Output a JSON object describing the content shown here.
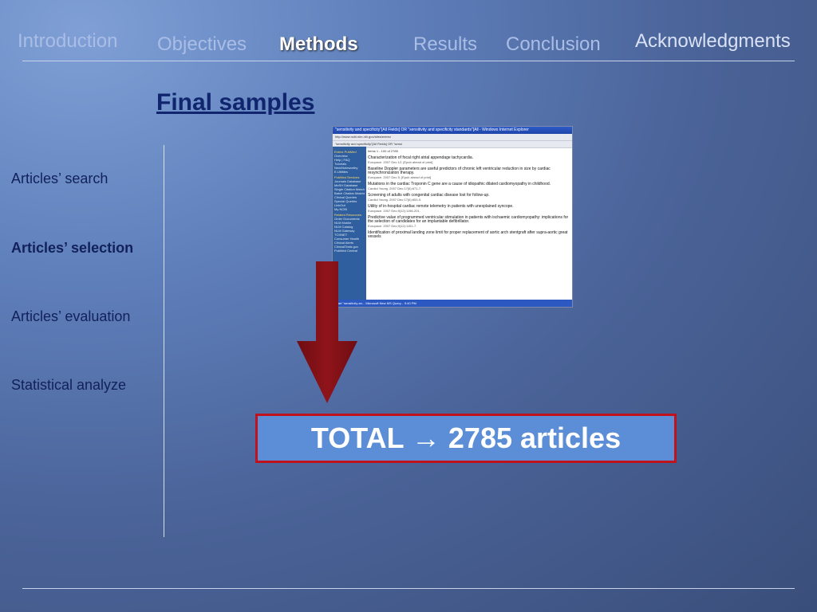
{
  "nav": {
    "items": [
      {
        "label": "Introduction",
        "active": false
      },
      {
        "label": "Objectives",
        "active": false
      },
      {
        "label": "Methods",
        "active": true
      },
      {
        "label": "Results",
        "active": false
      },
      {
        "label": "Conclusion",
        "active": false
      },
      {
        "label": "Acknowledgments",
        "active": false
      }
    ]
  },
  "slide": {
    "title": "Final samples",
    "side_items": [
      {
        "label": "Articles’ search",
        "bold": false
      },
      {
        "label": "Articles’ selection",
        "bold": true
      },
      {
        "label": "Articles’ evaluation",
        "bold": false
      },
      {
        "label": "Statistical analyze",
        "bold": false
      }
    ],
    "total_label": "TOTAL → 2785 articles"
  },
  "screenshot": {
    "window_title": "\"sensitivity and specificity\"[All Fields] OR \"sensitivity and specificity standards\"[All - Windows Internet Explorer",
    "address": "http://www.ncbi.nlm.nih.gov/sites/entrez",
    "tab": "\"sensitivity and specificity\"[All Fields] OR \"sensi",
    "hits": "Items 1 - 100 of 2785",
    "sidebar": [
      "Entrez PubMed",
      "Overview",
      "Help | FAQ",
      "Tutorials",
      "New/Noteworthy",
      "E-Utilities",
      "PubMed Services",
      "Journals Database",
      "MeSH Database",
      "Single Citation Matcher",
      "Batch Citation Matcher",
      "Clinical Queries",
      "Special Queries",
      "LinkOut",
      "My NCBI",
      "Related Resources",
      "Order Documents",
      "NLM Mobile",
      "NLM Catalog",
      "NLM Gateway",
      "TOXNET",
      "Consumer Health",
      "Clinical Alerts",
      "ClinicalTrials.gov",
      "PubMed Central"
    ],
    "records": [
      {
        "title": "Characterization of focal right atrial appendage tachycardia.",
        "source": "Europace. 2007 Dec 12; [Epub ahead of print]"
      },
      {
        "title": "Baseline Doppler parameters are useful predictors of chronic left ventricular reduction in size by cardiac resynchronization therapy.",
        "source": "Europace. 2007 Dec 5; [Epub ahead of print]"
      },
      {
        "title": "Mutations in the cardiac Troponin C gene are a cause of idiopathic dilated cardiomyopathy in childhood.",
        "source": "Cardiol Young. 2007 Dec;17(6):671-7."
      },
      {
        "title": "Screening of adults with congenital cardiac disease lost for follow-up.",
        "source": "Cardiol Young. 2007 Dec;17(6):653-9."
      },
      {
        "title": "Utility of in-hospital cardiac remote telemetry in patients with unexplained syncope.",
        "source": "Europace. 2007 Dec;9(12):1196-201."
      },
      {
        "title": "Predictive value of programmed ventricular stimulation in patients with ischaemic cardiomyopathy: implications for the selection of candidates for an implantable defibrillator.",
        "source": "Europace. 2007 Dec;9(12):1151-7."
      },
      {
        "title": "Identification of proximal landing zone limit for proper replacement of aortic arch stentgraft after supra-aortic great vessels",
        "source": ""
      }
    ],
    "taskbar": "Start    \"sensitivity an...    Microsoft    New MS Query...    9:40 PM"
  }
}
